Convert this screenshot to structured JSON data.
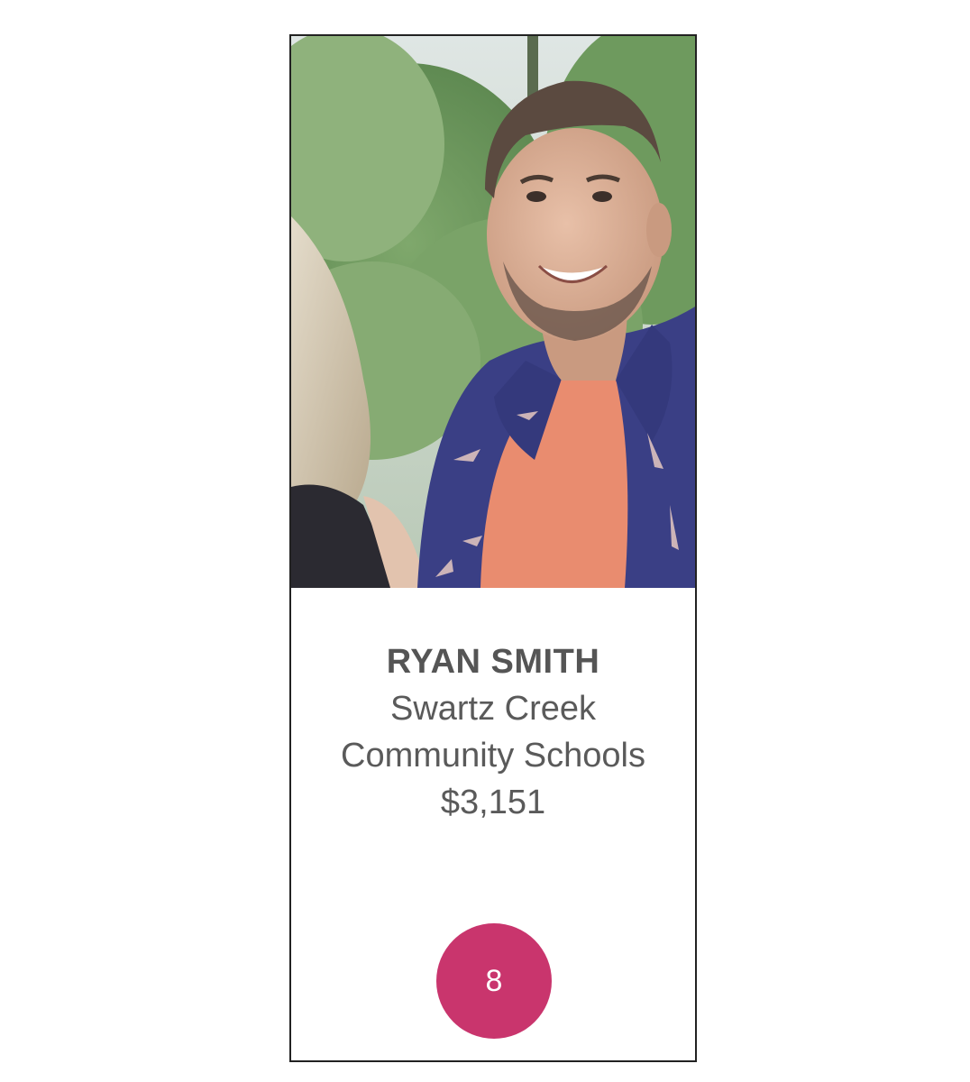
{
  "card": {
    "name": "RYAN SMITH",
    "org_line1": "Swartz Creek",
    "org_line2": "Community Schools",
    "amount": "$3,151",
    "rank": "8"
  },
  "colors": {
    "badge": "#c9356d",
    "text": "#5a5a5a",
    "border": "#222222"
  },
  "icons": {
    "photo": "portrait-photo"
  }
}
